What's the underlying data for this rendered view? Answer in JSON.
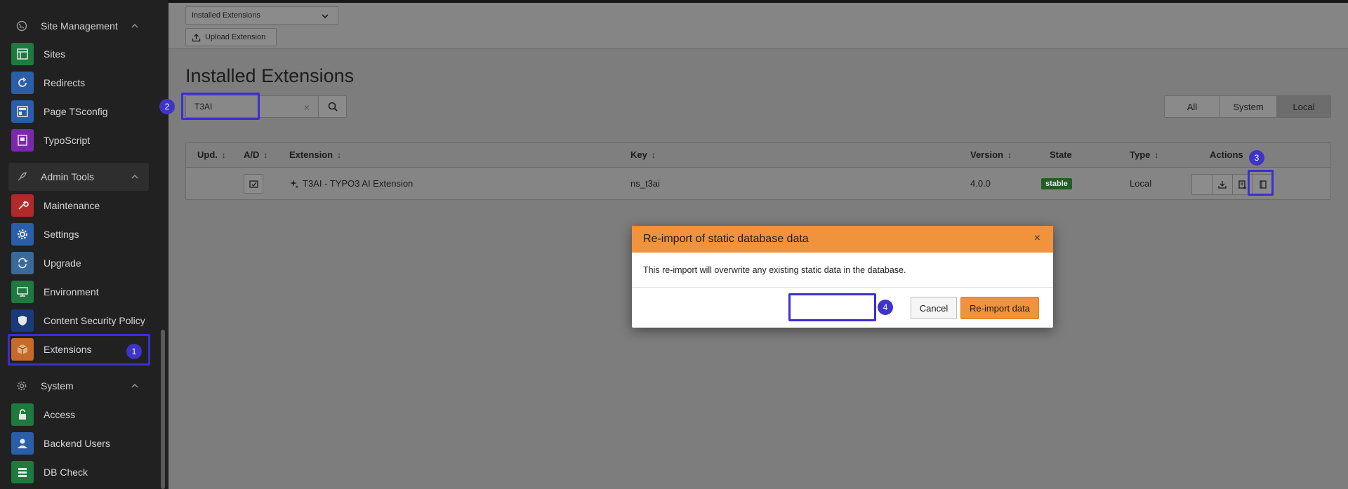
{
  "sidebar": {
    "groups": [
      {
        "label": "Site Management",
        "icon": "globe-icon"
      },
      {
        "label": "Admin Tools",
        "icon": "rocket-icon"
      },
      {
        "label": "System",
        "icon": "gear-icon"
      }
    ],
    "items": [
      {
        "label": "Sites",
        "icon": "sites-icon",
        "color": "#1e7a3f"
      },
      {
        "label": "Redirects",
        "icon": "redirect-icon",
        "color": "#2a5ea8"
      },
      {
        "label": "Page TSconfig",
        "icon": "page-tsconfig-icon",
        "color": "#2a5ea8"
      },
      {
        "label": "TypoScript",
        "icon": "typoscript-icon",
        "color": "#7a2aa8"
      },
      {
        "label": "Maintenance",
        "icon": "wrench-icon",
        "color": "#b02a2a"
      },
      {
        "label": "Settings",
        "icon": "cog-icon",
        "color": "#2a5ea8"
      },
      {
        "label": "Upgrade",
        "icon": "refresh-icon",
        "color": "#3a6a9a"
      },
      {
        "label": "Environment",
        "icon": "monitor-icon",
        "color": "#1e7a3f"
      },
      {
        "label": "Content Security Policy",
        "icon": "shield-icon",
        "color": "#1a3a7a"
      },
      {
        "label": "Extensions",
        "icon": "box-icon",
        "color": "#c56a2a"
      },
      {
        "label": "Access",
        "icon": "lock-icon",
        "color": "#1e7a3f"
      },
      {
        "label": "Backend Users",
        "icon": "user-icon",
        "color": "#2a5ea8"
      },
      {
        "label": "DB Check",
        "icon": "database-icon",
        "color": "#1e7a3f"
      }
    ]
  },
  "docheader": {
    "select_value": "Installed Extensions",
    "upload_label": "Upload Extension"
  },
  "page_title": "Installed Extensions",
  "search": {
    "value": "T3AI",
    "clear": "×"
  },
  "filters": [
    "All",
    "System",
    "Local"
  ],
  "table": {
    "headers": [
      "Upd.",
      "A/D",
      "Extension",
      "Key",
      "Version",
      "State",
      "Type",
      "Actions"
    ],
    "sort_glyph": "↕",
    "row": {
      "extension": "T3AI - TYPO3 AI Extension",
      "key": "ns_t3ai",
      "version": "4.0.0",
      "state": "stable",
      "type": "Local"
    }
  },
  "modal": {
    "title": "Re-import of static database data",
    "close": "×",
    "body": "This re-import will overwrite any existing static data in the database.",
    "cancel": "Cancel",
    "confirm": "Re-import data"
  },
  "annotations": [
    "1",
    "2",
    "3",
    "4"
  ],
  "colors": {
    "highlight": "#3a2ed4",
    "modal_accent": "#f0933c",
    "stable_badge": "#1f5f22"
  }
}
